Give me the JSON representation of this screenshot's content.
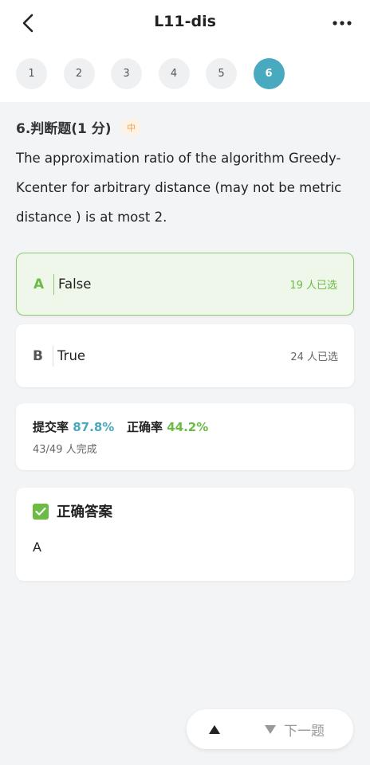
{
  "header": {
    "title": "L11-dis",
    "back_icon": "chevron-left-icon",
    "more_icon": "ellipsis-icon"
  },
  "steps": [
    "1",
    "2",
    "3",
    "4",
    "5",
    "6"
  ],
  "active_step": "6",
  "question": {
    "number_type": "6.判断题(1 分)",
    "difficulty": "中",
    "text": "The approximation ratio of the algorithm Greedy-Kcenter for arbitrary distance (may not be metric distance ) is at most 2."
  },
  "options": [
    {
      "letter": "A",
      "text": "False",
      "count": "19 人已选"
    },
    {
      "letter": "B",
      "text": "True",
      "count": "24 人已选"
    }
  ],
  "stats": {
    "submit_label": "提交率",
    "submit_rate": "87.8%",
    "correct_label": "正确率",
    "correct_rate": "44.2%",
    "completion": "43/49 人完成"
  },
  "answer": {
    "title": "正确答案",
    "value": "A"
  },
  "nav": {
    "next_label": "下一题"
  },
  "colors": {
    "accent": "#49a9be",
    "correct": "#6cbb45",
    "difficulty": "#f0a050"
  }
}
